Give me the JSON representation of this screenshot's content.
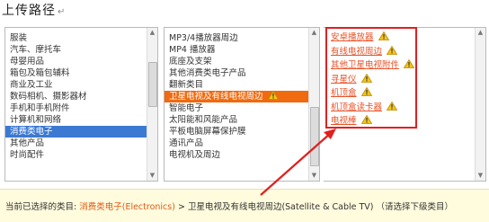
{
  "title": "上传路径",
  "title_mark": "↵",
  "col1": {
    "items": [
      "服装",
      "汽车、摩托车",
      "母婴用品",
      "箱包及箱包辅料",
      "商业及工业",
      "数码相机、摄影器材",
      "手机和手机附件",
      "计算机和网络",
      "消费类电子",
      "其他产品",
      "时尚配件"
    ],
    "selected_index": 8
  },
  "col2": {
    "items": [
      "MP3/4播放器周边",
      "MP4 播放器",
      "底座及支架",
      "其他消费类电子产品",
      "翻新类目",
      "卫星电视及有线电视周边",
      "智能电子",
      "太阳能和风能产品",
      "平板电脑屏幕保护膜",
      "通讯产品",
      "电视机及周边"
    ],
    "selected_index": 5,
    "warn_indices": [
      5
    ]
  },
  "col3": {
    "items": [
      "安卓播放器",
      "有线电视周边",
      "其他卫星电视附件",
      "寻星仪",
      "机顶盒",
      "机顶盒读卡器",
      "电视棒"
    ],
    "warn_indices": [
      0,
      1,
      2,
      3,
      4,
      5,
      6
    ]
  },
  "bottom": {
    "prefix": "当前已选择的类目:",
    "path1": "消费类电子(Electronics)",
    "sep": " > ",
    "path2": "卫星电视及有线电视周边(Satellite & Cable TV)",
    "hint": "（请选择下级类目）"
  },
  "colors": {
    "accent": "#f06a0f",
    "selected_blue": "#3c79d2",
    "link": "#e8542a",
    "annotation": "#e02020",
    "bar_bg": "#fffbdd"
  },
  "icons": {
    "warning": "warning-icon",
    "scroll_up": "scroll-up-arrow-icon",
    "scroll_down": "scroll-down-arrow-icon"
  }
}
